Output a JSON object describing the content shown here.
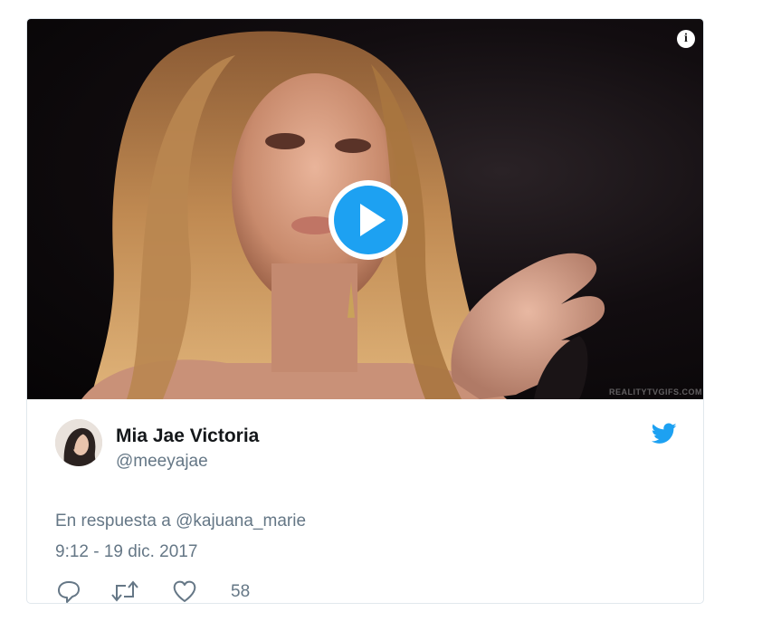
{
  "media": {
    "watermark": "REALITYTVGIFS.COM",
    "info_icon": "info-icon",
    "play_icon": "play-icon"
  },
  "tweet": {
    "author_name": "Mia Jae Victoria",
    "author_handle": "@meeyajae",
    "reply_prefix": "En respuesta a ",
    "reply_mention": "@kajuana_marie",
    "timestamp": "9:12 - 19 dic. 2017",
    "like_count": "58"
  },
  "colors": {
    "accent": "#1da1f2",
    "secondary_text": "#657786",
    "primary_text": "#14171a",
    "border": "#e1e8ed"
  }
}
